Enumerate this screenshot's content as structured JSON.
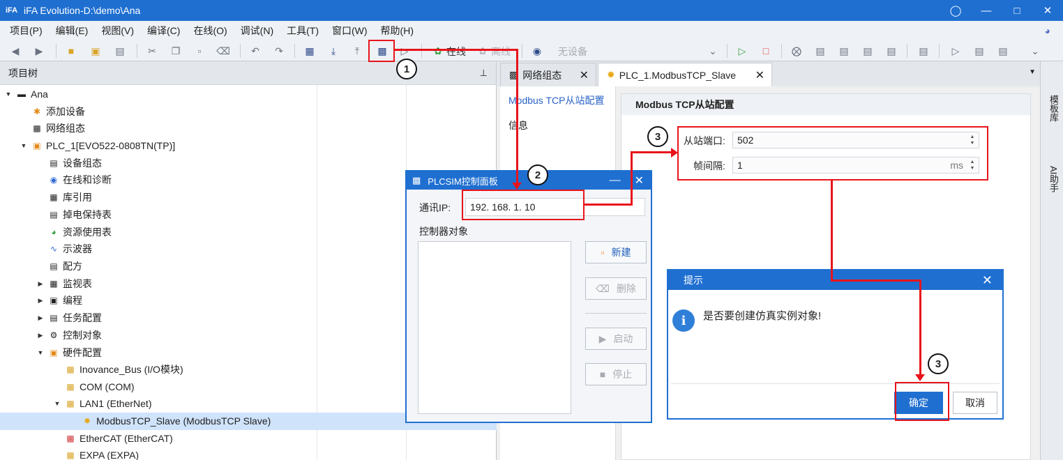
{
  "window": {
    "logo": "iFA",
    "title": "iFA Evolution-D:\\demo\\Ana",
    "icon_user": "user-icon",
    "icon_min": "minimize-icon",
    "icon_max": "maximize-icon",
    "icon_close": "close-icon"
  },
  "menu": [
    "项目(P)",
    "编辑(E)",
    "视图(V)",
    "编译(C)",
    "在线(O)",
    "调试(N)",
    "工具(T)",
    "窗口(W)",
    "帮助(H)"
  ],
  "toolbar": {
    "online": "在线",
    "offline": "离线",
    "no_device": "无设备"
  },
  "tree": {
    "header": "项目树",
    "items": [
      {
        "label": "Ana"
      },
      {
        "label": "添加设备"
      },
      {
        "label": "网络组态"
      },
      {
        "label": "PLC_1[EVO522-0808TN(TP)]"
      },
      {
        "label": "设备组态"
      },
      {
        "label": "在线和诊断"
      },
      {
        "label": "库引用"
      },
      {
        "label": "掉电保持表"
      },
      {
        "label": "资源使用表"
      },
      {
        "label": "示波器"
      },
      {
        "label": "配方"
      },
      {
        "label": "监视表"
      },
      {
        "label": "编程"
      },
      {
        "label": "任务配置"
      },
      {
        "label": "控制对象"
      },
      {
        "label": "硬件配置"
      },
      {
        "label": "Inovance_Bus (I/O模块)"
      },
      {
        "label": "COM (COM)"
      },
      {
        "label": "LAN1 (EtherNet)"
      },
      {
        "label": "ModbusTCP_Slave (ModbusTCP Slave)"
      },
      {
        "label": "EtherCAT (EtherCAT)"
      },
      {
        "label": "EXPA (EXPA)"
      }
    ]
  },
  "tabs": [
    "网络组态",
    "PLC_1.ModbusTCP_Slave"
  ],
  "nav": {
    "active": "Modbus TCP从站配置",
    "info": "信息"
  },
  "config": {
    "header": "Modbus TCP从站配置",
    "port_label": "从站端口:",
    "port_value": "502",
    "interval_label": "帧间隔:",
    "interval_value": "1",
    "interval_unit": "ms"
  },
  "right_panel": {
    "t1": "模板库",
    "t2": "AI助手"
  },
  "plcsim": {
    "title": "PLCSIM控制面板",
    "ip_label": "通讯IP:",
    "ip_value": "192. 168. 1. 10",
    "objects_label": "控制器对象",
    "new": "新建",
    "delete": "删除",
    "start": "启动",
    "stop": "停止"
  },
  "tip": {
    "title": "提示",
    "message": "是否要创建仿真实例对象!",
    "ok": "确定",
    "cancel": "取消"
  },
  "annotations": {
    "c1": "1",
    "c2": "2",
    "c3a": "3",
    "c3b": "3"
  }
}
